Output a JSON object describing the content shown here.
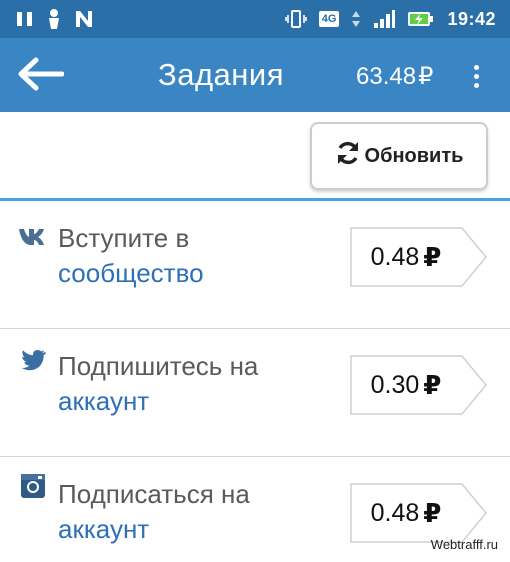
{
  "status_bar": {
    "network": "4G",
    "time": "19:42",
    "icons": [
      "pause-icon",
      "person-icon",
      "n-icon",
      "vibrate-icon",
      "signal-icon",
      "battery-charging-icon"
    ]
  },
  "app_bar": {
    "title": "Задания",
    "balance": "63.48",
    "currency": "₽"
  },
  "toolbar": {
    "refresh_label": "Обновить"
  },
  "tasks": [
    {
      "icon": "vk-icon",
      "line1": "Вступите в",
      "line2": "сообщество",
      "price": "0.48",
      "currency": "₽"
    },
    {
      "icon": "twitter-icon",
      "line1": "Подпишитесь на",
      "line2": "аккаунт",
      "price": "0.30",
      "currency": "₽"
    },
    {
      "icon": "instagram-icon",
      "line1": "Подписаться на",
      "line2": "аккаунт",
      "price": "0.48",
      "currency": "₽"
    }
  ],
  "watermark": "Webtrafff.ru",
  "colors": {
    "status_bar": "#2a6fa8",
    "app_bar": "#3a86c4",
    "divider": "#47a3e3",
    "link": "#2d70b8"
  }
}
